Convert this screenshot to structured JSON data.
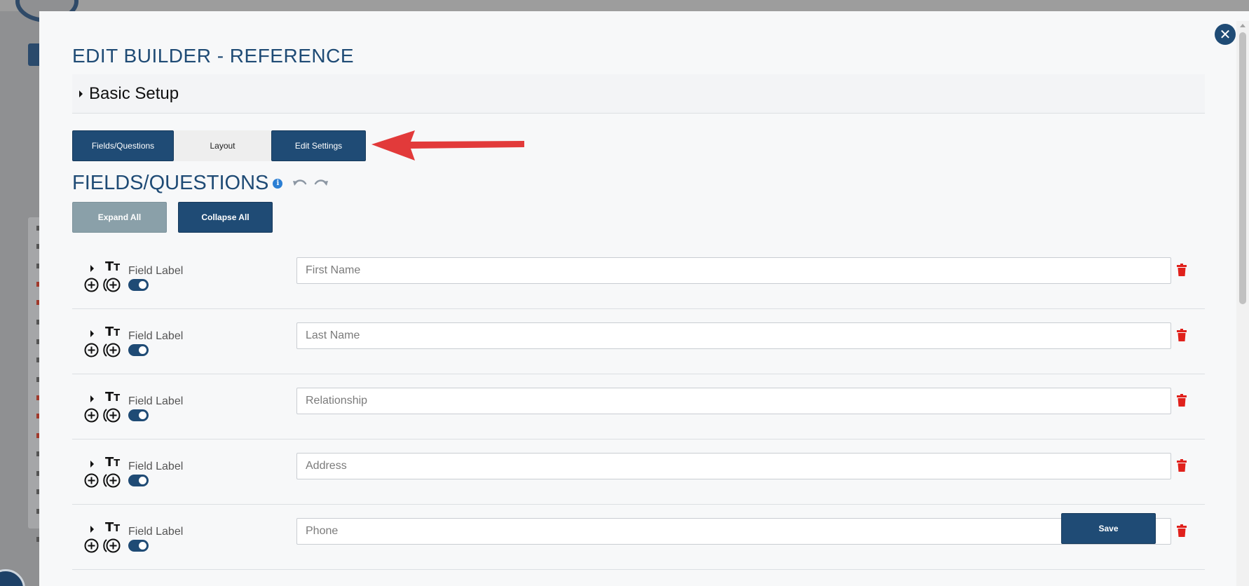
{
  "modal": {
    "title": "EDIT BUILDER - REFERENCE",
    "close_icon": "close-icon",
    "basic_setup_label": "Basic Setup"
  },
  "tabs": [
    {
      "label": "Fields/Questions",
      "active": true
    },
    {
      "label": "Layout",
      "active": false
    },
    {
      "label": "Edit Settings",
      "active": true
    }
  ],
  "section": {
    "title": "FIELDS/QUESTIONS",
    "info_icon": "i",
    "expand_all_label": "Expand All",
    "collapse_all_label": "Collapse All"
  },
  "fields": [
    {
      "type_icon": "text-size-icon",
      "label": "Field Label",
      "placeholder": "First Name",
      "enabled": true
    },
    {
      "type_icon": "text-size-icon",
      "label": "Field Label",
      "placeholder": "Last Name",
      "enabled": true
    },
    {
      "type_icon": "text-size-icon",
      "label": "Field Label",
      "placeholder": "Relationship",
      "enabled": true
    },
    {
      "type_icon": "text-size-icon",
      "label": "Field Label",
      "placeholder": "Address",
      "enabled": true
    },
    {
      "type_icon": "text-size-icon",
      "label": "Field Label",
      "placeholder": "Phone",
      "enabled": true
    }
  ],
  "save_label": "Save",
  "colors": {
    "primary": "#1f4b75",
    "disabled_button": "#8aa0a9",
    "delete": "#e0211c",
    "annotation_arrow": "#e23a3a",
    "info": "#2b7fd4"
  },
  "tt_icon": {
    "big": "T",
    "small": "T"
  }
}
